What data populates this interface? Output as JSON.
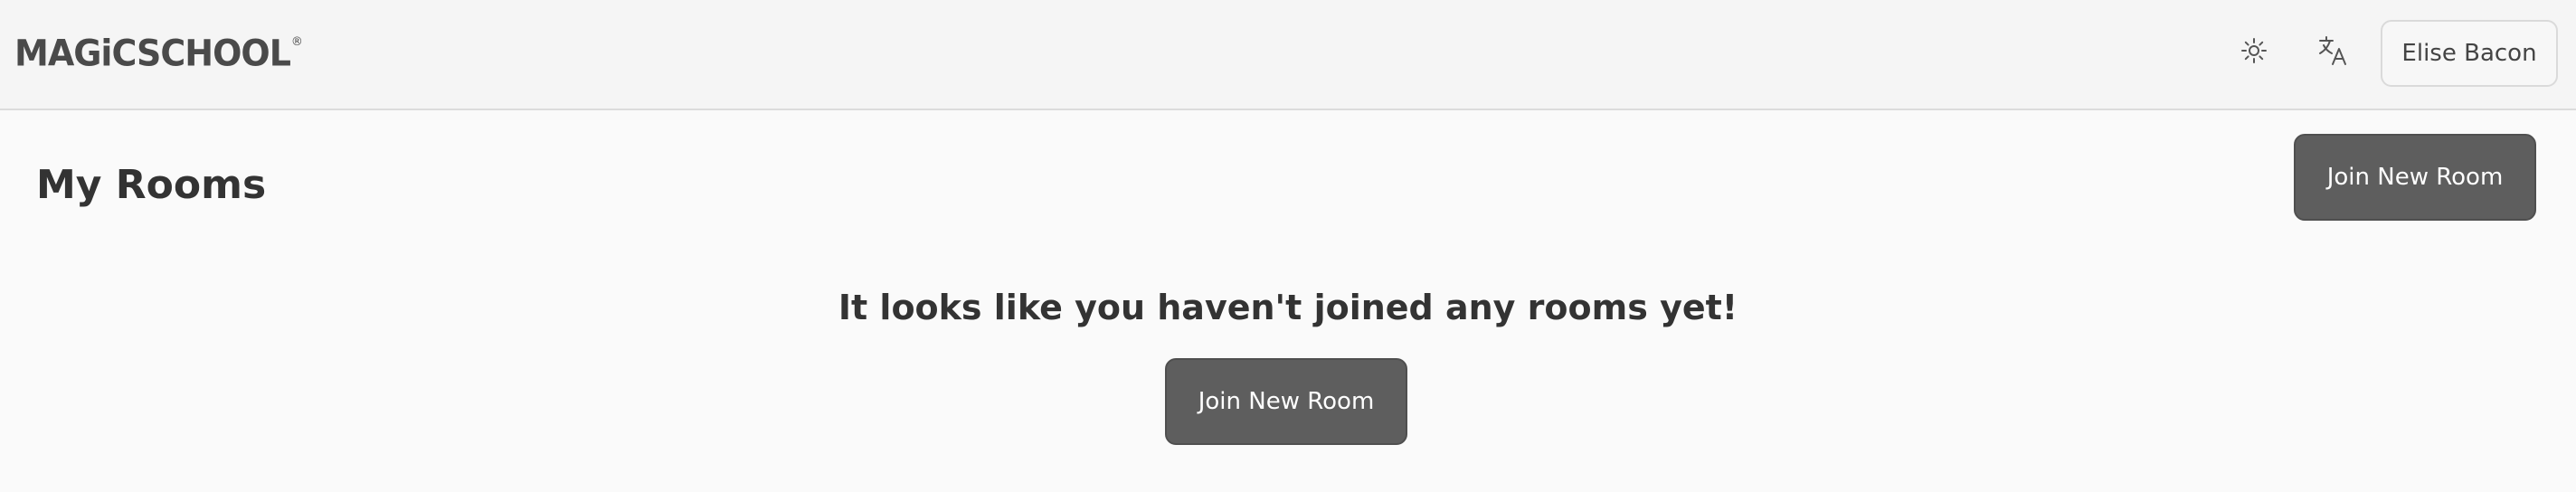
{
  "header": {
    "logo_text": "MAGiCSCHOOL",
    "logo_mark": "®",
    "theme_icon": "sun-icon",
    "language_icon": "translate-icon",
    "user_name": "Elise Bacon"
  },
  "main": {
    "title": "My Rooms",
    "join_button_label": "Join New Room",
    "empty_message": "It looks like you haven't joined any rooms yet!",
    "empty_join_button_label": "Join New Room"
  },
  "colors": {
    "header_bg": "#f5f5f5",
    "page_bg": "#fafafa",
    "button_dark": "#5e5e5e",
    "text": "#333333"
  }
}
